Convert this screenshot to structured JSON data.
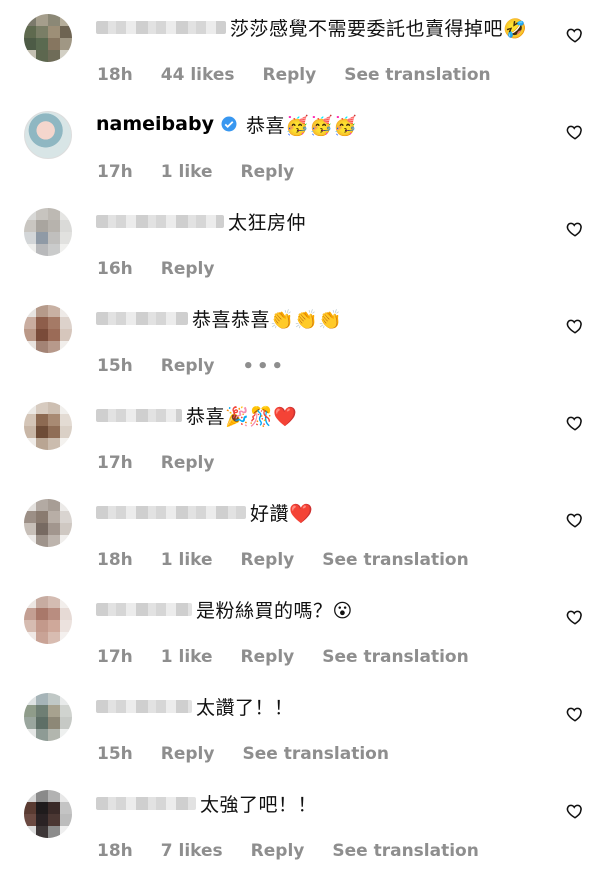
{
  "comments": [
    {
      "username": "",
      "text": "莎莎感覺不需要委託也賣得掉吧🤣",
      "time": "18h",
      "likes": "44 likes",
      "reply": "Reply",
      "translate": "See translation",
      "more": ""
    },
    {
      "username": "nameibaby",
      "text": "恭喜🥳🥳🥳",
      "time": "17h",
      "likes": "1 like",
      "reply": "Reply",
      "translate": "",
      "more": ""
    },
    {
      "username": "",
      "text": "太狂房仲",
      "time": "16h",
      "likes": "",
      "reply": "Reply",
      "translate": "",
      "more": ""
    },
    {
      "username": "",
      "text": "恭喜恭喜👏👏👏",
      "time": "15h",
      "likes": "",
      "reply": "Reply",
      "translate": "",
      "more": "•••"
    },
    {
      "username": "",
      "text": "恭喜🎉🎊❤️",
      "time": "17h",
      "likes": "",
      "reply": "Reply",
      "translate": "",
      "more": ""
    },
    {
      "username": "",
      "text": "好讚❤️",
      "time": "18h",
      "likes": "1 like",
      "reply": "Reply",
      "translate": "See translation",
      "more": ""
    },
    {
      "username": "",
      "text": "是粉絲買的嗎？😮",
      "time": "17h",
      "likes": "1 like",
      "reply": "Reply",
      "translate": "See translation",
      "more": ""
    },
    {
      "username": "",
      "text": "太讚了！！",
      "time": "15h",
      "likes": "",
      "reply": "Reply",
      "translate": "See translation",
      "more": ""
    },
    {
      "username": "",
      "text": "太強了吧！！",
      "time": "18h",
      "likes": "7 likes",
      "reply": "Reply",
      "translate": "See translation",
      "more": ""
    }
  ],
  "colors": {
    "meta": "#8e8e8e",
    "verified": "#3897f0"
  },
  "icons": {
    "like": "heart-outline-icon",
    "verified": "verified-badge-icon",
    "more": "more-options-icon"
  }
}
